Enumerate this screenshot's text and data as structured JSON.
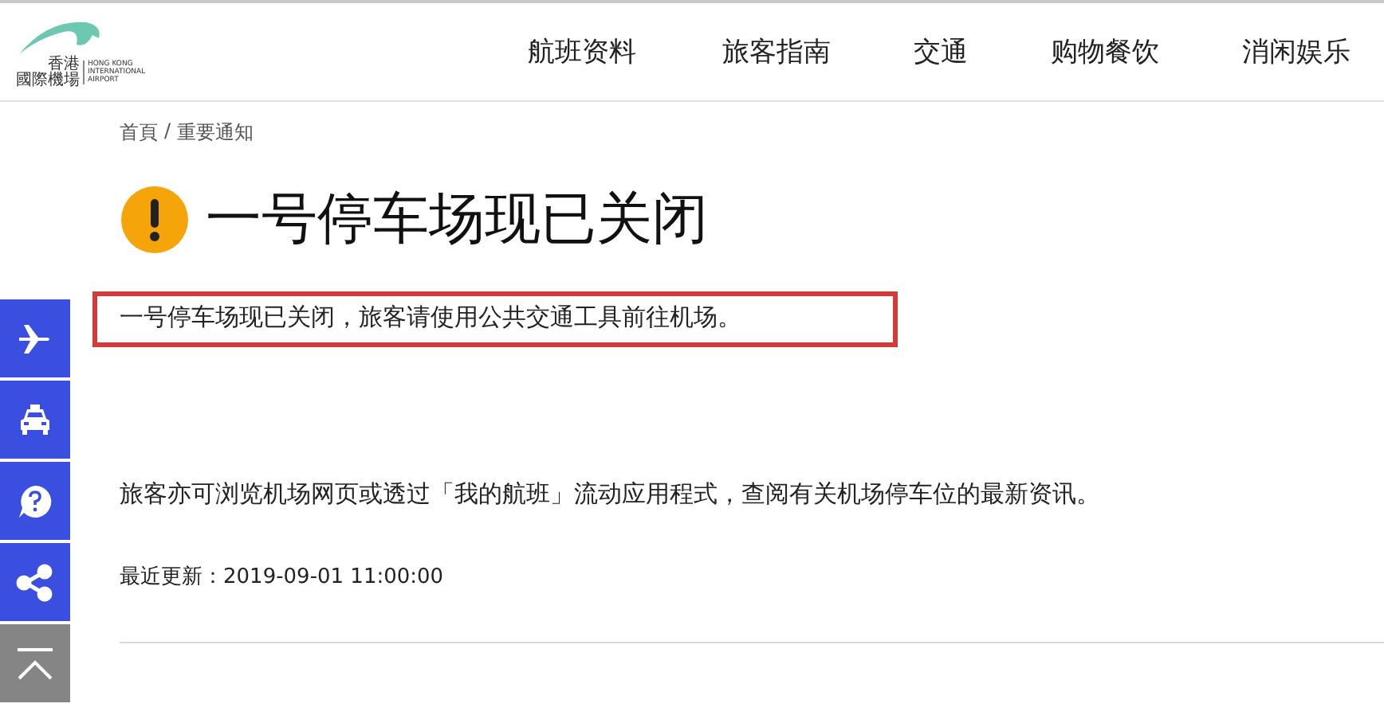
{
  "logo": {
    "chinese_lines": [
      "香港",
      "國際機場"
    ],
    "english_lines": [
      "HONG KONG",
      "INTERNATIONAL",
      "AIRPORT"
    ]
  },
  "nav": [
    "航班资料",
    "旅客指南",
    "交通",
    "购物餐饮",
    "消闲娱乐"
  ],
  "breadcrumb": [
    "首頁",
    "重要通知"
  ],
  "breadcrumb_separator": "/",
  "title": "一号停车场现已关闭",
  "notice": "一号停车场现已关闭，旅客请使用公共交通工具前往机场。",
  "paragraph": "旅客亦可浏览机场网页或透过「我的航班」流动应用程式，查阅有关机场停车位的最新资讯。",
  "updated": "最近更新：2019-09-01 11:00:00",
  "side_buttons": [
    {
      "kind": "plane"
    },
    {
      "kind": "taxi"
    },
    {
      "kind": "help"
    },
    {
      "kind": "share"
    },
    {
      "kind": "top"
    }
  ]
}
